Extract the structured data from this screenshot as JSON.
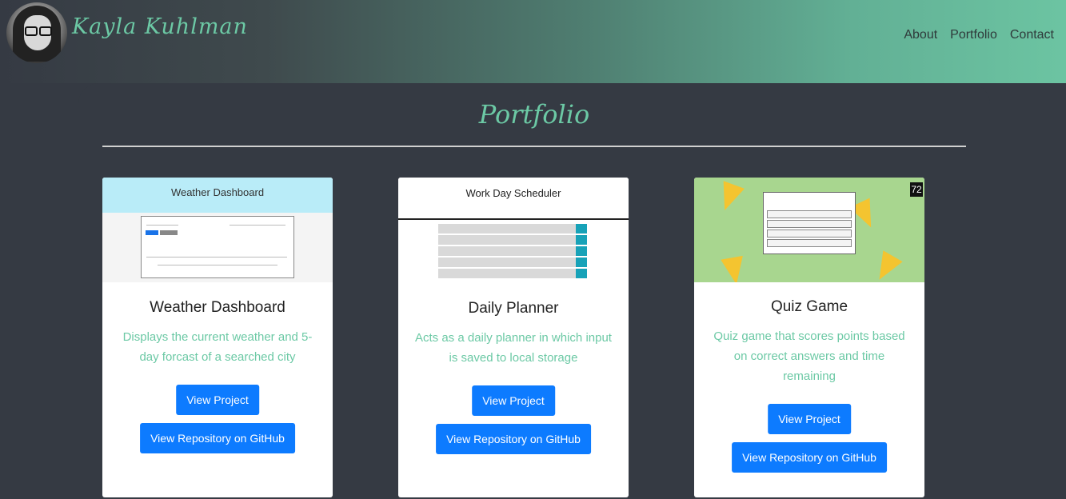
{
  "header": {
    "name": "Kayla Kuhlman",
    "nav": [
      "About",
      "Portfolio",
      "Contact"
    ]
  },
  "page": {
    "title": "Portfolio"
  },
  "projects": [
    {
      "title": "Weather Dashboard",
      "description": "Displays the current weather and 5-day forcast of a searched city",
      "thumb_title": "Weather Dashboard",
      "view_label": "View Project",
      "repo_label": "View Repository on GitHub"
    },
    {
      "title": "Daily Planner",
      "description": "Acts as a daily planner in which input is saved to local storage",
      "thumb_title": "Work Day Scheduler",
      "view_label": "View Project",
      "repo_label": "View Repository on GitHub"
    },
    {
      "title": "Quiz Game",
      "description": "Quiz game that scores points based on correct answers and time remaining",
      "thumb_timer": "72",
      "view_label": "View Project",
      "repo_label": "View Repository on GitHub"
    }
  ],
  "colors": {
    "accent": "#6cc9a5",
    "button": "#0d7bff",
    "background": "#353a43"
  }
}
